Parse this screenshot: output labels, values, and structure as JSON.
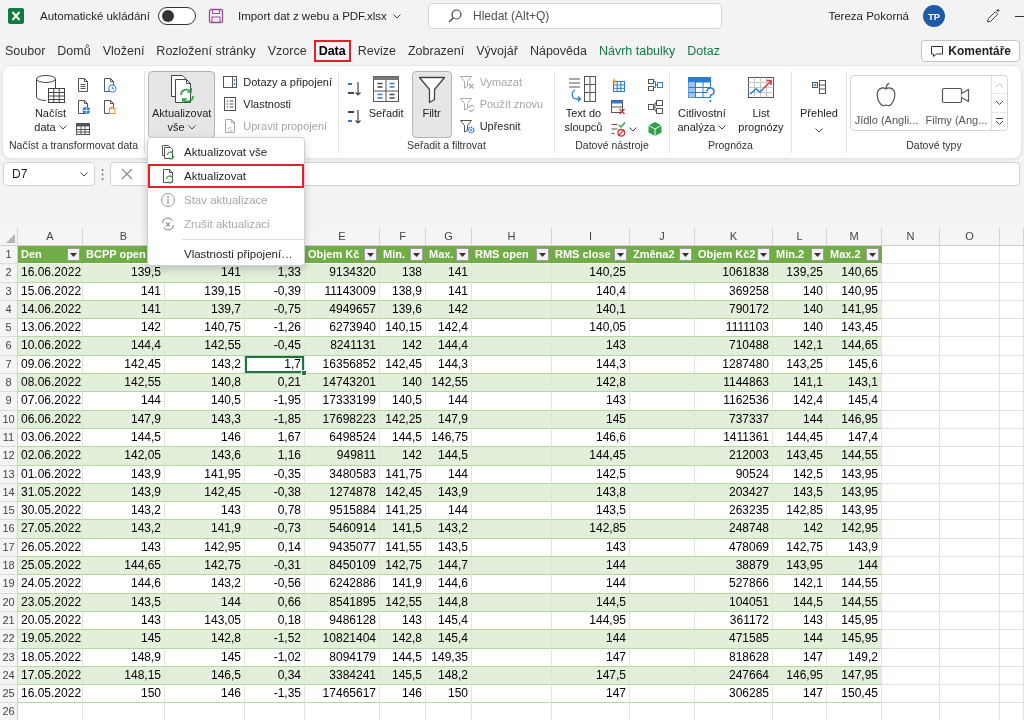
{
  "title_bar": {
    "autosave_label": "Automatické ukládání",
    "autosave_on": false,
    "file_name": "Import dat z webu a PDF.xlsx",
    "search_placeholder": "Hledat (Alt+Q)",
    "user_name": "Tereza Pokorná",
    "user_initials": "TP"
  },
  "tabs": [
    {
      "label": "Soubor",
      "selected": false,
      "contextual": false,
      "highlighted": false
    },
    {
      "label": "Domů",
      "selected": false,
      "contextual": false,
      "highlighted": false
    },
    {
      "label": "Vložení",
      "selected": false,
      "contextual": false,
      "highlighted": false
    },
    {
      "label": "Rozložení stránky",
      "selected": false,
      "contextual": false,
      "highlighted": false
    },
    {
      "label": "Vzorce",
      "selected": false,
      "contextual": false,
      "highlighted": false
    },
    {
      "label": "Data",
      "selected": true,
      "contextual": false,
      "highlighted": true
    },
    {
      "label": "Revize",
      "selected": false,
      "contextual": false,
      "highlighted": false
    },
    {
      "label": "Zobrazení",
      "selected": false,
      "contextual": false,
      "highlighted": false
    },
    {
      "label": "Vývojář",
      "selected": false,
      "contextual": false,
      "highlighted": false
    },
    {
      "label": "Nápověda",
      "selected": false,
      "contextual": false,
      "highlighted": false
    },
    {
      "label": "Návrh tabulky",
      "selected": false,
      "contextual": true,
      "highlighted": false
    },
    {
      "label": "Dotaz",
      "selected": false,
      "contextual": true,
      "highlighted": false
    }
  ],
  "comments_button": "Komentáře",
  "ribbon": [
    {
      "label": "Načíst a transformovat data",
      "controls": [
        {
          "kind": "large",
          "label": "Načíst\ndata",
          "dropdown": true,
          "pressed": false
        },
        {
          "kind": "icons"
        }
      ]
    },
    {
      "controls": [
        {
          "kind": "large",
          "label": "Aktualizovat\nvše",
          "dropdown": true,
          "pressed": true
        },
        {
          "kind": "small",
          "label": "Dotazy a připojení",
          "disabled": false
        },
        {
          "kind": "small",
          "label": "Vlastnosti",
          "disabled": false
        },
        {
          "kind": "small",
          "label": "Upravit propojení",
          "disabled": true
        }
      ]
    },
    {
      "label": "Seřadit a filtrovat",
      "controls": [
        {
          "kind": "icons"
        },
        {
          "kind": "large",
          "label": "Seřadit",
          "dropdown": false,
          "pressed": false
        },
        {
          "kind": "large",
          "label": "Filtr",
          "dropdown": false,
          "pressed": true
        },
        {
          "kind": "small",
          "label": "Vymazat",
          "disabled": true
        },
        {
          "kind": "small",
          "label": "Použít znovu",
          "disabled": true
        },
        {
          "kind": "small",
          "label": "Upřesnit",
          "disabled": false
        }
      ]
    },
    {
      "label": "Datové nástroje",
      "controls": [
        {
          "kind": "large",
          "label": "Text do\nsloupců",
          "dropdown": false,
          "pressed": false
        },
        {
          "kind": "icons"
        }
      ]
    },
    {
      "label": "Prognóza",
      "controls": [
        {
          "kind": "large",
          "label": "Citlivostní\nanalýza",
          "dropdown": true,
          "pressed": false
        },
        {
          "kind": "large",
          "label": "List\nprognózy",
          "dropdown": false,
          "pressed": false
        }
      ]
    },
    {
      "controls": [
        {
          "kind": "large",
          "label": "Přehled",
          "dropdown": true,
          "pressed": false
        }
      ]
    },
    {
      "label": "Datové typy",
      "controls": [
        {
          "kind": "gallery",
          "items": [
            "Jídlo (Angli...",
            "Filmy (Ang..."
          ],
          "scroll_up_disabled": true
        }
      ]
    }
  ],
  "formula_bar": {
    "name_box": "D7"
  },
  "sheet": {
    "columns": [
      {
        "letter": "A",
        "header": "Den",
        "filter": true
      },
      {
        "letter": "B",
        "header": "BCPP open"
      },
      {},
      {},
      {
        "letter": "E",
        "header": "Objem Kč",
        "filter": true
      },
      {
        "letter": "F",
        "header": "Min.",
        "filter": true
      },
      {
        "letter": "G",
        "header": "Max.",
        "filter": true
      },
      {
        "letter": "H",
        "header": "RMS open",
        "filter": true
      },
      {
        "letter": "I",
        "header": "RMS close",
        "filter": true
      },
      {
        "letter": "J",
        "header": "Změna2",
        "filter": true
      },
      {
        "letter": "K",
        "header": "Objem Kč2",
        "filter": true
      },
      {
        "letter": "L",
        "header": "Min.2",
        "filter": true
      },
      {
        "letter": "M",
        "header": "Max.2",
        "filter": true
      },
      {
        "letter": "N"
      },
      {
        "letter": "O"
      }
    ],
    "rows": [
      {
        "number": "1",
        "kind": "header"
      },
      {
        "number": "2",
        "kind": "data",
        "cells": [
          "16.06.2022",
          "139,5",
          "141",
          "1,33",
          "9134320",
          "138",
          "141",
          null,
          "140,25",
          null,
          "1061838",
          "139,25",
          "140,65"
        ]
      },
      {
        "number": "3",
        "kind": "data",
        "cells": [
          "15.06.2022",
          "141",
          "139,15",
          "-0,39",
          "11143009",
          "138,9",
          "141",
          null,
          "140,4",
          null,
          "369258",
          "140",
          "140,95"
        ]
      },
      {
        "number": "4",
        "kind": "data",
        "cells": [
          "14.06.2022",
          "141",
          "139,7",
          "-0,75",
          "4949657",
          "139,6",
          "142",
          null,
          "140,1",
          null,
          "790172",
          "140",
          "141,95"
        ]
      },
      {
        "number": "5",
        "kind": "data",
        "cells": [
          "13.06.2022",
          "142",
          "140,75",
          "-1,26",
          "6273940",
          "140,15",
          "142,4",
          null,
          "140,05",
          null,
          "1111103",
          "140",
          "143,45"
        ]
      },
      {
        "number": "6",
        "kind": "data",
        "cells": [
          "10.06.2022",
          "144,4",
          "142,55",
          "-0,45",
          "8241131",
          "142",
          "144,4",
          null,
          "143",
          null,
          "710488",
          "142,1",
          "144,65"
        ]
      },
      {
        "number": "7",
        "kind": "data",
        "cells": [
          "09.06.2022",
          "142,45",
          "143,2",
          {
            "text": "1,7",
            "active": true
          },
          "16356852",
          "142,45",
          "144,3",
          null,
          "144,3",
          null,
          "1287480",
          "143,25",
          "145,6"
        ]
      },
      {
        "number": "8",
        "kind": "data",
        "cells": [
          "08.06.2022",
          "142,55",
          "140,8",
          "0,21",
          "14743201",
          "140",
          "142,55",
          null,
          "142,8",
          null,
          "1144863",
          "141,1",
          "143,1"
        ]
      },
      {
        "number": "9",
        "kind": "data",
        "cells": [
          "07.06.2022",
          "144",
          "140,5",
          "-1,95",
          "17333199",
          "140,5",
          "144",
          null,
          "143",
          null,
          "1162536",
          "142,4",
          "145,4"
        ]
      },
      {
        "number": "10",
        "kind": "data",
        "cells": [
          "06.06.2022",
          "147,9",
          "143,3",
          "-1,85",
          "17698223",
          "142,25",
          "147,9",
          null,
          "145",
          null,
          "737337",
          "144",
          "146,95"
        ]
      },
      {
        "number": "11",
        "kind": "data",
        "cells": [
          "03.06.2022",
          "144,5",
          "146",
          "1,67",
          "6498524",
          "144,5",
          "146,75",
          null,
          "146,6",
          null,
          "1411361",
          "144,45",
          "147,4"
        ]
      },
      {
        "number": "12",
        "kind": "data",
        "cells": [
          "02.06.2022",
          "142,05",
          "143,6",
          "1,16",
          "949811",
          "142",
          "144,5",
          null,
          "144,45",
          null,
          "212003",
          "143,45",
          "144,55"
        ]
      },
      {
        "number": "13",
        "kind": "data",
        "cells": [
          "01.06.2022",
          "143,9",
          "141,95",
          "-0,35",
          "3480583",
          "141,75",
          "144",
          null,
          "142,5",
          null,
          "90524",
          "142,5",
          "143,95"
        ]
      },
      {
        "number": "14",
        "kind": "data",
        "cells": [
          "31.05.2022",
          "143,9",
          "142,45",
          "-0,38",
          "1274878",
          "142,45",
          "143,9",
          null,
          "143,8",
          null,
          "203427",
          "143,5",
          "143,95"
        ]
      },
      {
        "number": "15",
        "kind": "data",
        "cells": [
          "30.05.2022",
          "143,2",
          "143",
          "0,78",
          "9515884",
          "141,25",
          "144",
          null,
          "143,5",
          null,
          "263235",
          "142,85",
          "143,95"
        ]
      },
      {
        "number": "16",
        "kind": "data",
        "cells": [
          "27.05.2022",
          "143,2",
          "141,9",
          "-0,73",
          "5460914",
          "141,5",
          "143,2",
          null,
          "142,85",
          null,
          "248748",
          "142",
          "142,95"
        ]
      },
      {
        "number": "17",
        "kind": "data",
        "cells": [
          "26.05.2022",
          "143",
          "142,95",
          "0,14",
          "9435077",
          "141,55",
          "143,5",
          null,
          "143",
          null,
          "478069",
          "142,75",
          "143,9"
        ]
      },
      {
        "number": "18",
        "kind": "data",
        "cells": [
          "25.05.2022",
          "144,65",
          "142,75",
          "-0,31",
          "8450109",
          "142,75",
          "144,7",
          null,
          "144",
          null,
          "38879",
          "143,95",
          "144"
        ]
      },
      {
        "number": "19",
        "kind": "data",
        "cells": [
          "24.05.2022",
          "144,6",
          "143,2",
          "-0,56",
          "6242886",
          "141,9",
          "144,6",
          null,
          "144",
          null,
          "527866",
          "142,1",
          "144,55"
        ]
      },
      {
        "number": "20",
        "kind": "data",
        "cells": [
          "23.05.2022",
          "143,5",
          "144",
          "0,66",
          "8541895",
          "142,55",
          "144,8",
          null,
          "144,5",
          null,
          "104051",
          "144,5",
          "144,55"
        ]
      },
      {
        "number": "21",
        "kind": "data",
        "cells": [
          "20.05.2022",
          "143",
          "143,05",
          "0,18",
          "9486128",
          "143",
          "145,4",
          null,
          "144,95",
          null,
          "361172",
          "143",
          "145,95"
        ]
      },
      {
        "number": "22",
        "kind": "data",
        "cells": [
          "19.05.2022",
          "145",
          "142,8",
          "-1,52",
          "10821404",
          "142,8",
          "145,4",
          null,
          "144",
          null,
          "471585",
          "144",
          "145,95"
        ]
      },
      {
        "number": "23",
        "kind": "data",
        "cells": [
          "18.05.2022",
          "148,9",
          "145",
          "-1,02",
          "8094179",
          "144,5",
          "149,35",
          null,
          "147",
          null,
          "818628",
          "147",
          "149,2"
        ]
      },
      {
        "number": "24",
        "kind": "data",
        "cells": [
          "17.05.2022",
          "148,15",
          "146,5",
          "0,34",
          "3384241",
          "145,5",
          "148,2",
          null,
          "147,5",
          null,
          "247664",
          "146,95",
          "147,95"
        ]
      },
      {
        "number": "25",
        "kind": "data",
        "cells": [
          "16.05.2022",
          "150",
          "146",
          "-1,35",
          "17465617",
          "146",
          "150",
          null,
          "147",
          null,
          "306285",
          "147",
          "150,45"
        ]
      },
      {
        "number": "26",
        "kind": "blank"
      }
    ]
  },
  "refresh_menu": [
    {
      "kind": "item",
      "label": "Aktualizovat vše",
      "disabled": false,
      "highlighted": false
    },
    {
      "kind": "item",
      "label": "Aktualizovat",
      "disabled": false,
      "highlighted": true
    },
    {
      "kind": "item",
      "label": "Stav aktualizace",
      "disabled": true,
      "highlighted": false
    },
    {
      "kind": "item",
      "label": "Zrušit aktualizaci",
      "disabled": true,
      "highlighted": false
    },
    {
      "kind": "separator"
    },
    {
      "kind": "item",
      "label": "Vlastnosti připojení…",
      "disabled": false,
      "highlighted": false
    }
  ]
}
